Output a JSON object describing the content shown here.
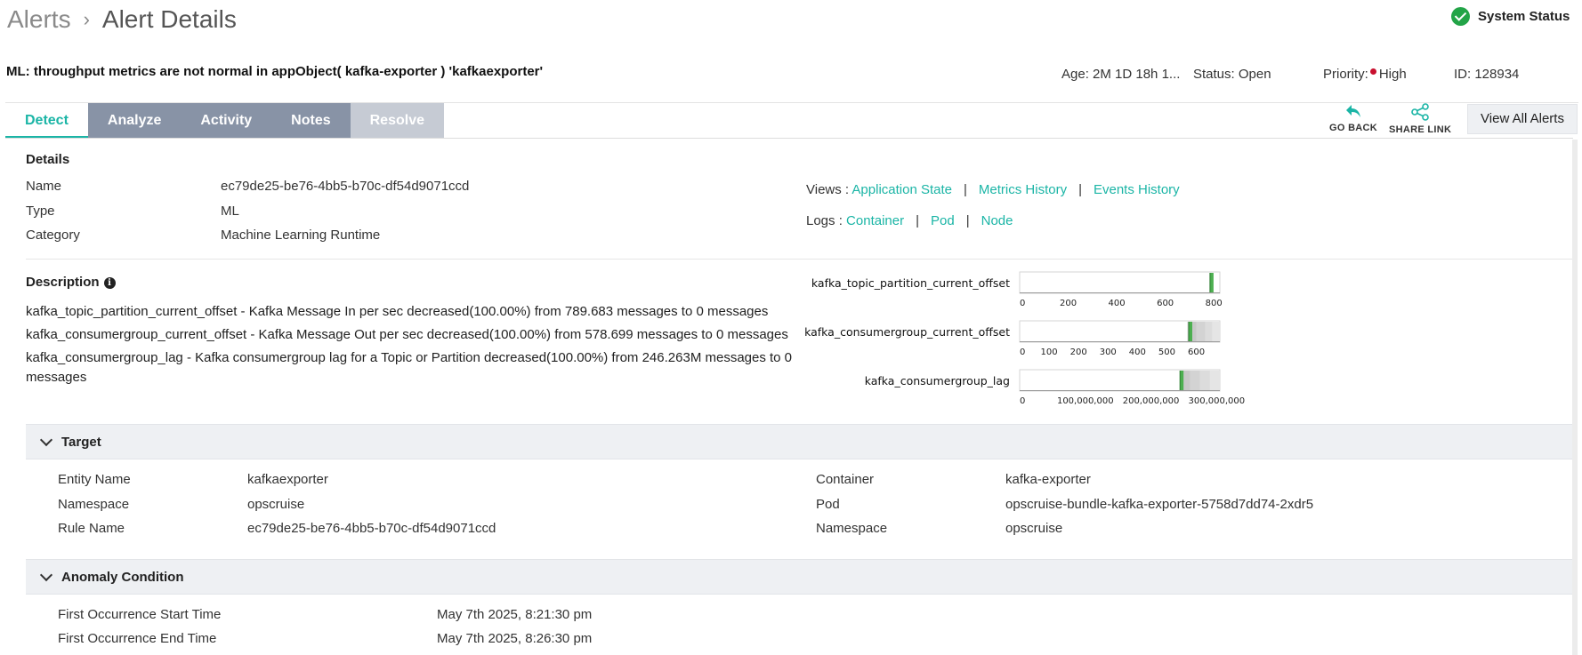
{
  "breadcrumb": {
    "root": "Alerts",
    "separator": "›",
    "current": "Alert Details"
  },
  "system_status": {
    "label": "System Status",
    "icon": "check-circle-icon",
    "color": "#22a447"
  },
  "alert": {
    "title": "ML: throughput metrics are not normal in appObject( kafka-exporter ) 'kafkaexporter'",
    "age": "Age: 2M 1D 18h 1...",
    "status": "Status: Open",
    "priority_label": "Priority:",
    "priority_value": "High",
    "priority_color": "#c8102e",
    "id": "ID: 128934"
  },
  "tabs": [
    {
      "label": "Detect",
      "state": "active"
    },
    {
      "label": "Analyze",
      "state": "normal"
    },
    {
      "label": "Activity",
      "state": "normal"
    },
    {
      "label": "Notes",
      "state": "normal"
    },
    {
      "label": "Resolve",
      "state": "disabled"
    }
  ],
  "toolbar": {
    "go_back": "GO BACK",
    "share_link": "SHARE LINK",
    "view_all": "View All Alerts",
    "accent": "#1bb5a6"
  },
  "details": {
    "heading": "Details",
    "rows": [
      {
        "label": "Name",
        "value": "ec79de25-be76-4bb5-b70c-df54d9071ccd"
      },
      {
        "label": "Type",
        "value": "ML"
      },
      {
        "label": "Category",
        "value": "Machine Learning Runtime"
      }
    ],
    "views_label": "Views :",
    "views": [
      "Application State",
      "Metrics History",
      "Events History"
    ],
    "logs_label": "Logs :",
    "logs": [
      "Container",
      "Pod",
      "Node"
    ]
  },
  "description": {
    "heading": "Description",
    "lines": [
      "kafka_topic_partition_current_offset - Kafka Message In per sec decreased(100.00%) from 789.683 messages to 0 messages",
      "kafka_consumergroup_current_offset - Kafka Message Out per sec decreased(100.00%) from 578.699 messages to 0 messages",
      "kafka_consumergroup_lag - Kafka consumergroup lag for a Topic or Partition decreased(100.00%) from 246.263M messages to 0 messages"
    ]
  },
  "chart_data": [
    {
      "type": "bar",
      "title": "kafka_topic_partition_current_offset",
      "xlim": [
        0,
        825
      ],
      "ticks": [
        0,
        200,
        400,
        600,
        800
      ],
      "tick_labels": [
        "0",
        "200",
        "400",
        "600",
        "800"
      ],
      "value": 789.683,
      "bands": [],
      "marker_color": "#4caf50"
    },
    {
      "type": "bar",
      "title": "kafka_consumergroup_current_offset",
      "xlim": [
        0,
        680
      ],
      "ticks": [
        0,
        100,
        200,
        300,
        400,
        500,
        600
      ],
      "tick_labels": [
        "0",
        "100",
        "200",
        "300",
        "400",
        "500",
        "600"
      ],
      "value": 578.699,
      "bands": [
        [
          570,
          600
        ],
        [
          600,
          630
        ],
        [
          630,
          655
        ],
        [
          655,
          680
        ]
      ],
      "marker_color": "#4caf50"
    },
    {
      "type": "bar",
      "title": "kafka_consumergroup_lag",
      "xlim": [
        0,
        305000000
      ],
      "ticks": [
        0,
        100000000,
        200000000,
        300000000
      ],
      "tick_labels": [
        "0",
        "100,000,000",
        "200,000,000",
        "300,000,000"
      ],
      "value": 246263000,
      "bands": [
        [
          246000000,
          260000000
        ],
        [
          260000000,
          275000000
        ],
        [
          275000000,
          290000000
        ],
        [
          290000000,
          305000000
        ]
      ],
      "marker_color": "#4caf50"
    }
  ],
  "target": {
    "heading": "Target",
    "left": [
      {
        "label": "Entity Name",
        "value": "kafkaexporter"
      },
      {
        "label": "Namespace",
        "value": "opscruise"
      },
      {
        "label": "Rule Name",
        "value": "ec79de25-be76-4bb5-b70c-df54d9071ccd"
      }
    ],
    "right": [
      {
        "label": "Container",
        "value": "kafka-exporter",
        "link": false
      },
      {
        "label": "Pod",
        "value": "opscruise-bundle-kafka-exporter-5758d7dd74-2xdr5",
        "link": true
      },
      {
        "label": "Namespace",
        "value": "opscruise",
        "link": false
      }
    ]
  },
  "anomaly": {
    "heading": "Anomaly Condition",
    "rows": [
      {
        "label": "First Occurrence Start Time",
        "value": "May 7th 2025, 8:21:30 pm"
      },
      {
        "label": "First Occurrence End Time",
        "value": "May 7th 2025, 8:26:30 pm"
      }
    ]
  }
}
